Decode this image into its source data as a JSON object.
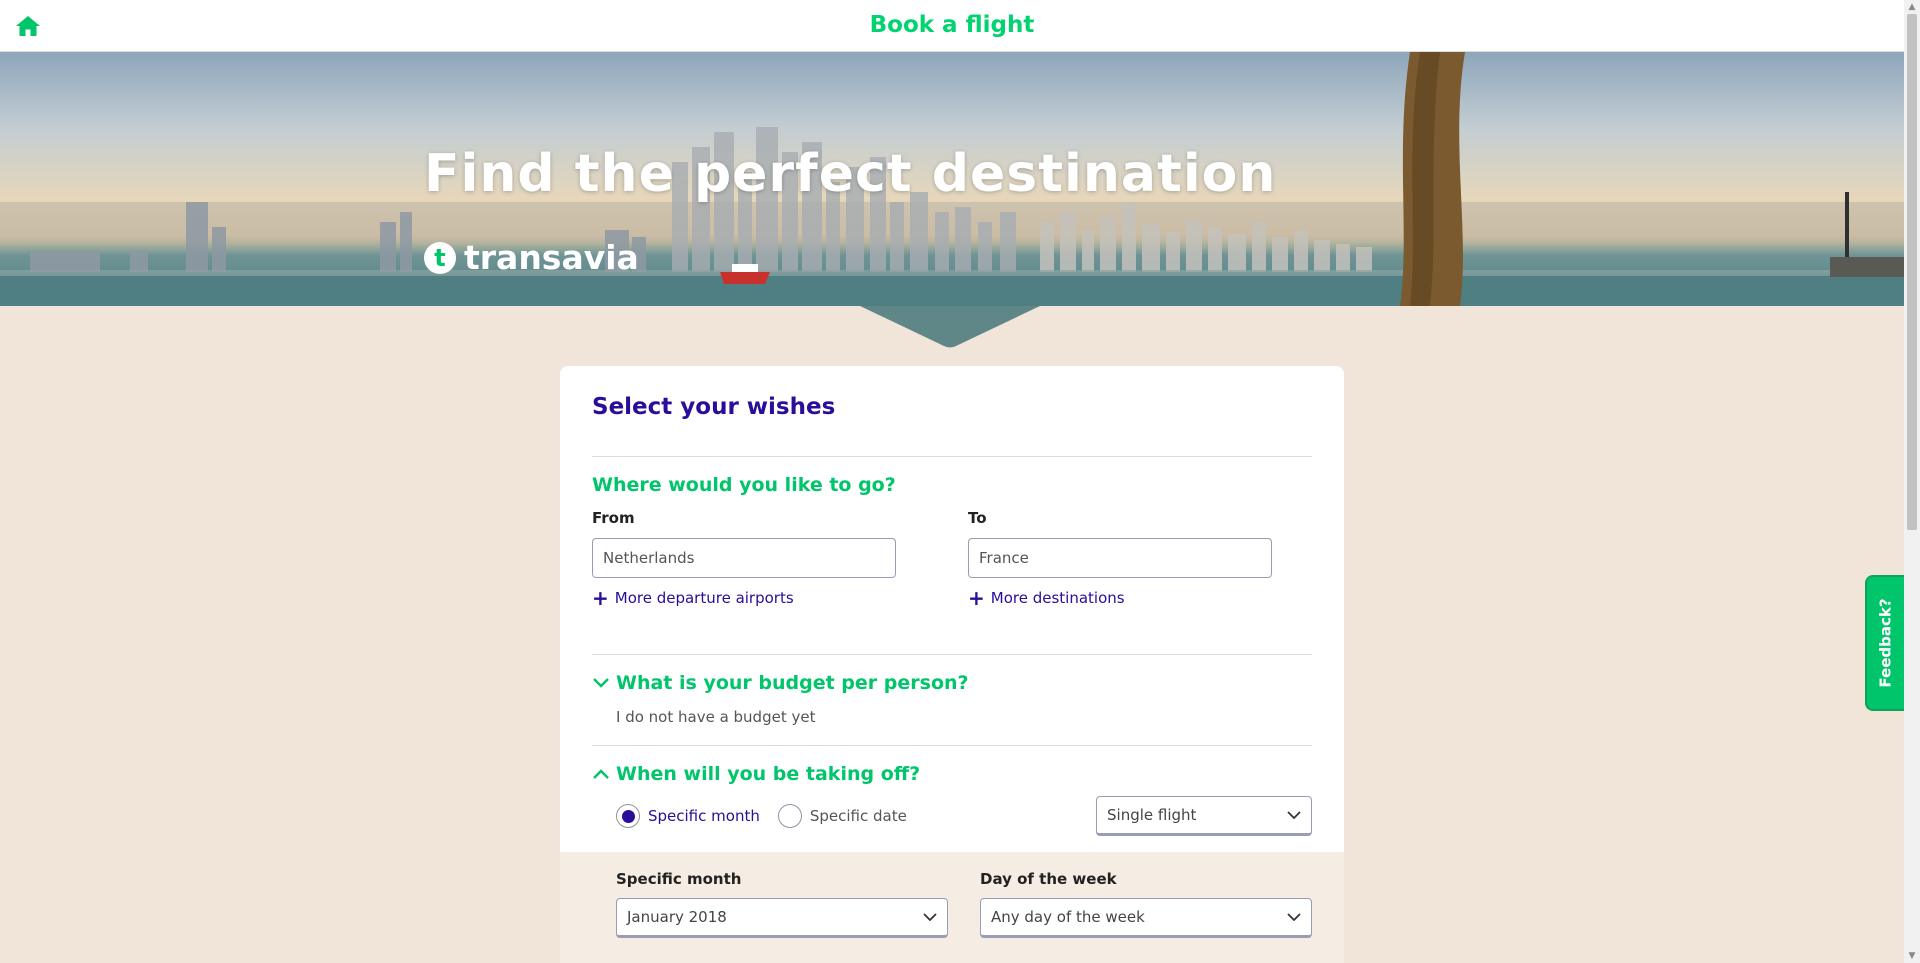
{
  "header": {
    "title": "Book a flight",
    "home_icon": "home-icon"
  },
  "hero": {
    "heading": "Find the perfect destination",
    "brand_mark": "t",
    "brand_name": "transavia"
  },
  "form": {
    "title": "Select your wishes",
    "where": {
      "heading": "Where would you like to go?",
      "from_label": "From",
      "from_value": "Netherlands",
      "to_label": "To",
      "to_value": "France",
      "more_departure": "More departure airports",
      "more_destinations": "More destinations"
    },
    "budget": {
      "heading": "What is your budget per person?",
      "value": "I do not have a budget yet",
      "expanded": false
    },
    "when": {
      "heading": "When will you be taking off?",
      "expanded": true,
      "radio_month": "Specific month",
      "radio_date": "Specific date",
      "selected_radio": "Specific month",
      "flight_type": "Single flight",
      "month_label": "Specific month",
      "month_value": "January 2018",
      "day_label": "Day of the week",
      "day_value": "Any day of the week"
    }
  },
  "feedback": {
    "label": "Feedback?"
  },
  "colors": {
    "brand_green": "#00c56a",
    "brand_purple": "#2a0d9a",
    "page_bg": "#f1e5da"
  }
}
